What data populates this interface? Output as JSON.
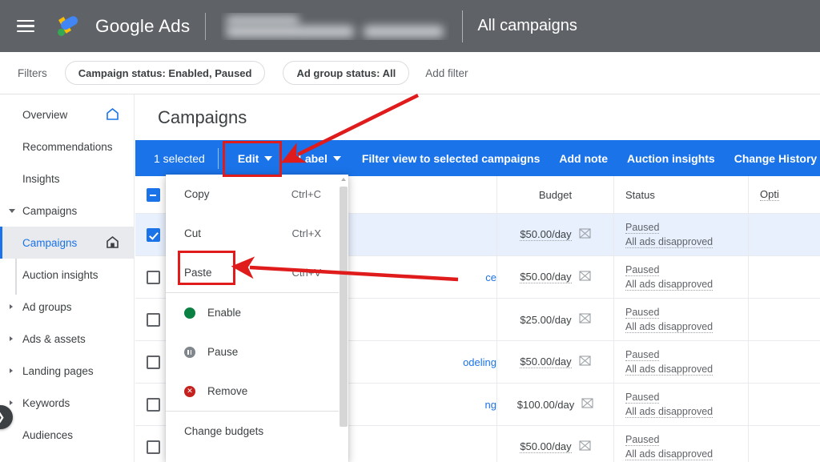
{
  "header": {
    "menu_icon": "hamburger-menu-icon",
    "brand": "Google Ads",
    "account_name_redacted": "",
    "page_scope": "All campaigns"
  },
  "filterbar": {
    "label": "Filters",
    "chips": [
      {
        "label": "Campaign status: Enabled, Paused"
      },
      {
        "label": "Ad group status: All"
      }
    ],
    "add_filter": "Add filter"
  },
  "sidebar": {
    "collapse_label": "❯",
    "items": [
      {
        "label": "Overview",
        "icon": "home-outline-icon",
        "expandable": false,
        "selected": false
      },
      {
        "label": "Recommendations",
        "icon": "",
        "expandable": false,
        "selected": false
      },
      {
        "label": "Insights",
        "icon": "",
        "expandable": false,
        "selected": false
      },
      {
        "label": "Campaigns",
        "icon": "",
        "expandable": true,
        "expanded": true,
        "selected": false
      },
      {
        "label": "Campaigns",
        "icon": "home-filled-icon",
        "sub": true,
        "selected": true
      },
      {
        "label": "Auction insights",
        "icon": "",
        "sub": true,
        "selected": false
      },
      {
        "label": "Ad groups",
        "icon": "",
        "expandable": true,
        "selected": false
      },
      {
        "label": "Ads & assets",
        "icon": "",
        "expandable": true,
        "selected": false
      },
      {
        "label": "Landing pages",
        "icon": "",
        "expandable": true,
        "selected": false
      },
      {
        "label": "Keywords",
        "icon": "",
        "expandable": true,
        "selected": false
      },
      {
        "label": "Audiences",
        "icon": "",
        "expandable": false,
        "selected": false
      }
    ]
  },
  "main": {
    "page_title": "Campaigns",
    "toolbar": {
      "selected_count": "1 selected",
      "edit": "Edit",
      "label": "Label",
      "filter_view": "Filter view to selected campaigns",
      "add_note": "Add note",
      "auction_insights": "Auction insights",
      "change_history": "Change History"
    },
    "table": {
      "columns": {
        "campaign": "",
        "budget": "Budget",
        "status": "Status",
        "optimization": "Opti"
      },
      "rows": [
        {
          "checked": true,
          "selected": true,
          "name": "",
          "budget": "$50.00/day",
          "status_line1": "Paused",
          "status_line2": "All ads disapproved",
          "optimization": ""
        },
        {
          "checked": false,
          "selected": false,
          "name": "ce",
          "budget": "$50.00/day",
          "status_line1": "Paused",
          "status_line2": "All ads disapproved",
          "optimization": ""
        },
        {
          "checked": false,
          "selected": false,
          "name": "",
          "budget": "$25.00/day",
          "status_line1": "Paused",
          "status_line2": "All ads disapproved",
          "optimization": ""
        },
        {
          "checked": false,
          "selected": false,
          "name": "odeling",
          "budget": "$50.00/day",
          "status_line1": "Paused",
          "status_line2": "All ads disapproved",
          "optimization": ""
        },
        {
          "checked": false,
          "selected": false,
          "name": "ng",
          "budget": "$100.00/day",
          "status_line1": "Paused",
          "status_line2": "All ads disapproved",
          "optimization": ""
        },
        {
          "checked": false,
          "selected": false,
          "name": "",
          "budget": "$50.00/day",
          "status_line1": "Paused",
          "status_line2": "All ads disapproved",
          "optimization": ""
        }
      ]
    }
  },
  "edit_menu": {
    "items": [
      {
        "label": "Copy",
        "accel": "Ctrl+C",
        "icon": ""
      },
      {
        "label": "Cut",
        "accel": "Ctrl+X",
        "icon": ""
      },
      {
        "label": "Paste",
        "accel": "Ctrl+V",
        "icon": ""
      },
      {
        "label": "Enable",
        "accel": "",
        "icon": "enable-dot-icon"
      },
      {
        "label": "Pause",
        "accel": "",
        "icon": "pause-circle-icon"
      },
      {
        "label": "Remove",
        "accel": "",
        "icon": "remove-circle-icon"
      },
      {
        "label": "Change budgets",
        "accel": "",
        "icon": ""
      }
    ]
  },
  "annotations": {
    "highlight_edit_button": "Edit",
    "highlight_paste_item": "Paste",
    "accent_red": "#e01b1b"
  },
  "colors": {
    "header_gray": "#5f6368",
    "toolbar_blue": "#1a73e8",
    "selected_row": "#e8f0fe",
    "sidebar_selected": "#e8eaed",
    "link_blue": "#1a73e8",
    "enable_green": "#0b8043",
    "pause_gray": "#80868b",
    "remove_red": "#c5221f"
  }
}
